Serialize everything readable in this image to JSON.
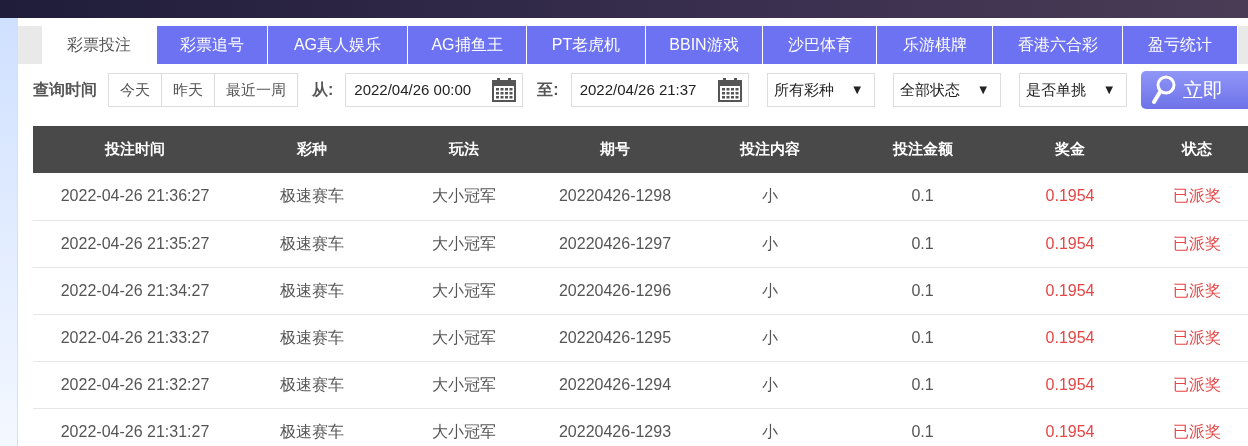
{
  "tabs": [
    {
      "label": "彩票投注",
      "selected": true
    },
    {
      "label": "彩票追号",
      "selected": false
    },
    {
      "label": "AG真人娱乐",
      "selected": false
    },
    {
      "label": "AG捕鱼王",
      "selected": false
    },
    {
      "label": "PT老虎机",
      "selected": false
    },
    {
      "label": "BBIN游戏",
      "selected": false
    },
    {
      "label": "沙巴体育",
      "selected": false
    },
    {
      "label": "乐游棋牌",
      "selected": false
    },
    {
      "label": "香港六合彩",
      "selected": false
    },
    {
      "label": "盈亏统计",
      "selected": false
    }
  ],
  "filter": {
    "label": "查询时间",
    "quick_ranges": [
      "今天",
      "昨天",
      "最近一周"
    ],
    "from_label": "从:",
    "from_value": "2022/04/26 00:00",
    "to_label": "至:",
    "to_value": "2022/04/26 21:37",
    "dropdowns": [
      {
        "value": "所有彩种",
        "arrow": "▼"
      },
      {
        "value": "全部状态",
        "arrow": "▼"
      },
      {
        "value": "是否单挑",
        "arrow": "▼"
      }
    ],
    "search_button": "立即"
  },
  "table": {
    "columns": [
      "投注时间",
      "彩种",
      "玩法",
      "期号",
      "投注内容",
      "投注金额",
      "奖金",
      "状态"
    ],
    "rows": [
      [
        "2022-04-26 21:36:27",
        "极速赛车",
        "大小冠军",
        "20220426-1298",
        "小",
        "0.1",
        "0.1954",
        "已派奖"
      ],
      [
        "2022-04-26 21:35:27",
        "极速赛车",
        "大小冠军",
        "20220426-1297",
        "小",
        "0.1",
        "0.1954",
        "已派奖"
      ],
      [
        "2022-04-26 21:34:27",
        "极速赛车",
        "大小冠军",
        "20220426-1296",
        "小",
        "0.1",
        "0.1954",
        "已派奖"
      ],
      [
        "2022-04-26 21:33:27",
        "极速赛车",
        "大小冠军",
        "20220426-1295",
        "小",
        "0.1",
        "0.1954",
        "已派奖"
      ],
      [
        "2022-04-26 21:32:27",
        "极速赛车",
        "大小冠军",
        "20220426-1294",
        "小",
        "0.1",
        "0.1954",
        "已派奖"
      ],
      [
        "2022-04-26 21:31:27",
        "极速赛车",
        "大小冠军",
        "20220426-1293",
        "小",
        "0.1",
        "0.1954",
        "已派奖"
      ]
    ]
  }
}
